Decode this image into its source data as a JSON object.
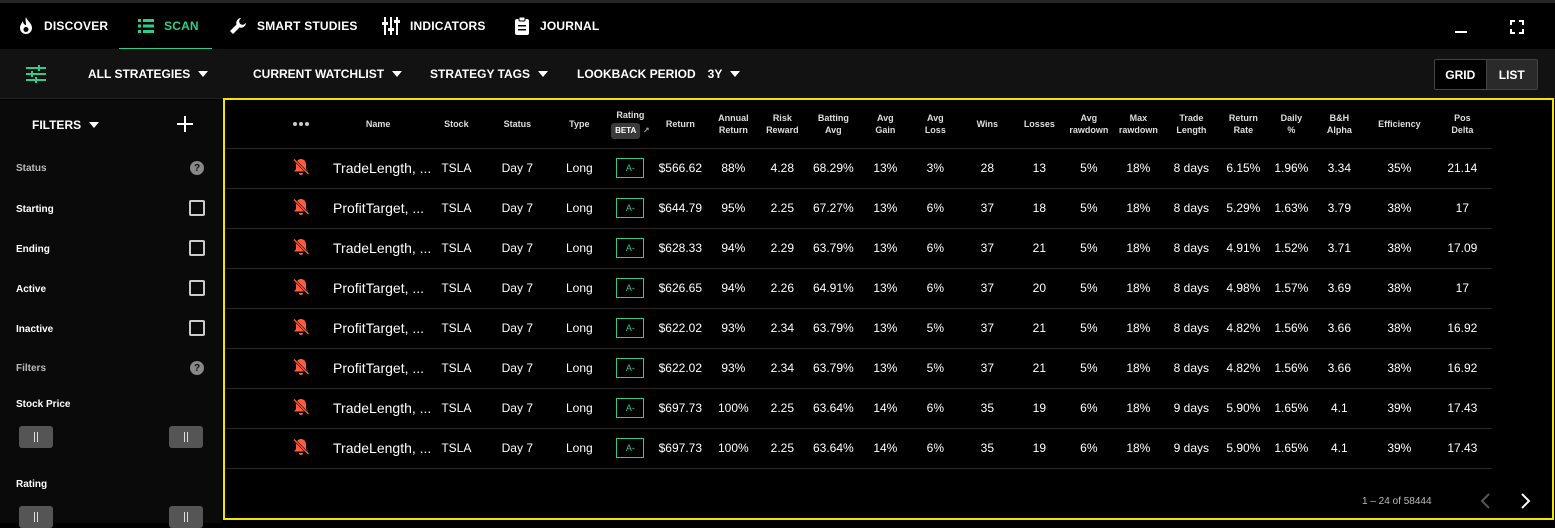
{
  "nav": {
    "tabs": [
      {
        "label": "DISCOVER",
        "icon": "fire-icon"
      },
      {
        "label": "SCAN",
        "icon": "list-icon"
      },
      {
        "label": "SMART STUDIES",
        "icon": "wrench-icon"
      },
      {
        "label": "INDICATORS",
        "icon": "sliders-icon"
      },
      {
        "label": "JOURNAL",
        "icon": "clipboard-icon"
      }
    ],
    "active_tab": "SCAN",
    "accent": "#2ecc8a"
  },
  "subbar": {
    "strategies": "ALL STRATEGIES",
    "watchlist": "CURRENT WATCHLIST",
    "tags": "STRATEGY TAGS",
    "lookback_label": "LOOKBACK PERIOD",
    "lookback_value": "3Y",
    "grid": "GRID",
    "list": "LIST"
  },
  "sidebar": {
    "title": "FILTERS",
    "status_label": "Status",
    "starting": "Starting",
    "ending": "Ending",
    "active": "Active",
    "inactive": "Inactive",
    "filters_label": "Filters",
    "stock_price": "Stock Price",
    "rating": "Rating",
    "help": "?"
  },
  "table": {
    "headers": {
      "name": "Name",
      "stock": "Stock",
      "status": "Status",
      "type": "Type",
      "rating": "Rating",
      "beta": "BETA",
      "return": "Return",
      "annual_return_1": "Annual",
      "annual_return_2": "Return",
      "risk_reward_1": "Risk",
      "risk_reward_2": "Reward",
      "batting_1": "Batting",
      "batting_2": "Avg",
      "avg_gain_1": "Avg",
      "avg_gain_2": "Gain",
      "avg_loss_1": "Avg",
      "avg_loss_2": "Loss",
      "wins": "Wins",
      "losses": "Losses",
      "avg_dd_1": "Avg",
      "avg_dd_2": "rawdown",
      "max_dd_1": "Max",
      "max_dd_2": "rawdown",
      "trade_len_1": "Trade",
      "trade_len_2": "Length",
      "return_rate_1": "Return",
      "return_rate_2": "Rate",
      "daily_1": "Daily",
      "daily_2": "%",
      "bh_1": "B&H",
      "bh_2": "Alpha",
      "efficiency": "Efficiency",
      "pos_delta_1": "Pos",
      "pos_delta_2": "Delta"
    },
    "rows": [
      [
        "TradeLength, ...",
        "TSLA",
        "Day 7",
        "Long",
        "A-",
        "$566.62",
        "88%",
        "4.28",
        "68.29%",
        "13%",
        "3%",
        "28",
        "13",
        "5%",
        "18%",
        "8 days",
        "6.15%",
        "1.96%",
        "3.34",
        "35%",
        "21.14"
      ],
      [
        "ProfitTarget, ...",
        "TSLA",
        "Day 7",
        "Long",
        "A-",
        "$644.79",
        "95%",
        "2.25",
        "67.27%",
        "13%",
        "6%",
        "37",
        "18",
        "5%",
        "18%",
        "8 days",
        "5.29%",
        "1.63%",
        "3.79",
        "38%",
        "17"
      ],
      [
        "TradeLength, ...",
        "TSLA",
        "Day 7",
        "Long",
        "A-",
        "$628.33",
        "94%",
        "2.29",
        "63.79%",
        "13%",
        "6%",
        "37",
        "21",
        "5%",
        "18%",
        "8 days",
        "4.91%",
        "1.52%",
        "3.71",
        "38%",
        "17.09"
      ],
      [
        "ProfitTarget, ...",
        "TSLA",
        "Day 7",
        "Long",
        "A-",
        "$626.65",
        "94%",
        "2.26",
        "64.91%",
        "13%",
        "6%",
        "37",
        "20",
        "5%",
        "18%",
        "8 days",
        "4.98%",
        "1.57%",
        "3.69",
        "38%",
        "17"
      ],
      [
        "ProfitTarget, ...",
        "TSLA",
        "Day 7",
        "Long",
        "A-",
        "$622.02",
        "93%",
        "2.34",
        "63.79%",
        "13%",
        "5%",
        "37",
        "21",
        "5%",
        "18%",
        "8 days",
        "4.82%",
        "1.56%",
        "3.66",
        "38%",
        "16.92"
      ],
      [
        "ProfitTarget, ...",
        "TSLA",
        "Day 7",
        "Long",
        "A-",
        "$622.02",
        "93%",
        "2.34",
        "63.79%",
        "13%",
        "5%",
        "37",
        "21",
        "5%",
        "18%",
        "8 days",
        "4.82%",
        "1.56%",
        "3.66",
        "38%",
        "16.92"
      ],
      [
        "TradeLength, ...",
        "TSLA",
        "Day 7",
        "Long",
        "A-",
        "$697.73",
        "100%",
        "2.25",
        "63.64%",
        "14%",
        "6%",
        "35",
        "19",
        "6%",
        "18%",
        "9 days",
        "5.90%",
        "1.65%",
        "4.1",
        "39%",
        "17.43"
      ],
      [
        "TradeLength, ...",
        "TSLA",
        "Day 7",
        "Long",
        "A-",
        "$697.73",
        "100%",
        "2.25",
        "63.64%",
        "14%",
        "6%",
        "35",
        "19",
        "6%",
        "18%",
        "9 days",
        "5.90%",
        "1.65%",
        "4.1",
        "39%",
        "17.43"
      ]
    ],
    "pagination": "1 – 24 of 58444",
    "alert_color": "#ff5a3c",
    "highlight_border": "#f5e400"
  }
}
